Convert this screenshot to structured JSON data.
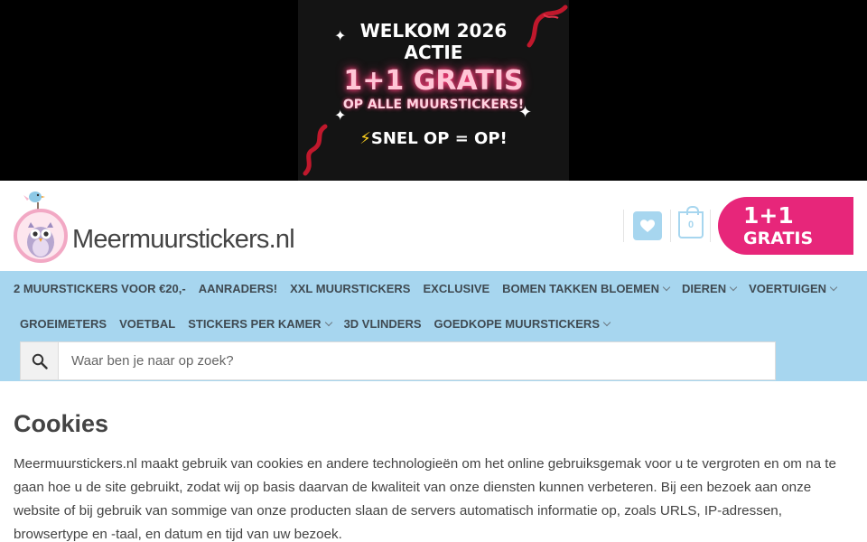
{
  "promo_banner": {
    "line1": "WELKOM 2026",
    "line2": "ACTIE",
    "line3": "1+1 GRATIS",
    "line4": "OP ALLE MUURSTICKERS!",
    "line5_icon": "lightning-icon",
    "line5": "SNEL OP = OP!"
  },
  "header": {
    "logo_text": "Meermuurstickers.nl",
    "wishlist_icon": "heart-icon",
    "cart_count": "0",
    "promo_badge": {
      "line1": "1+1",
      "line2": "GRATIS"
    }
  },
  "nav": {
    "row1": [
      {
        "label": "2 MUURSTICKERS VOOR €20,-",
        "dropdown": false
      },
      {
        "label": "AANRADERS!",
        "dropdown": false
      },
      {
        "label": "XXL MUURSTICKERS",
        "dropdown": false
      },
      {
        "label": "EXCLUSIVE",
        "dropdown": false
      },
      {
        "label": "BOMEN TAKKEN BLOEMEN",
        "dropdown": true
      },
      {
        "label": "DIEREN",
        "dropdown": true
      },
      {
        "label": "VOERTUIGEN",
        "dropdown": true
      }
    ],
    "row2": [
      {
        "label": "GROEIMETERS",
        "dropdown": false
      },
      {
        "label": "VOETBAL",
        "dropdown": false
      },
      {
        "label": "STICKERS PER KAMER",
        "dropdown": true
      },
      {
        "label": "3D VLINDERS",
        "dropdown": false
      },
      {
        "label": "GOEDKOPE MUURSTICKERS",
        "dropdown": true
      }
    ]
  },
  "search": {
    "placeholder": "Waar ben je naar op zoek?",
    "value": ""
  },
  "content": {
    "title": "Cookies",
    "paragraph": "Meermuurstickers.nl maakt gebruik van cookies en andere technologieën om het online gebruiksgemak voor u te vergroten en om na te gaan hoe u de site gebruikt, zodat wij op basis daarvan de kwaliteit van onze diensten kunnen verbeteren. Bij een bezoek aan onze website of bij gebruik van sommige van onze producten slaan de servers automatisch informatie op, zoals URLS, IP-adressen, browsertype en -taal, en datum en tijd van uw bezoek."
  },
  "colors": {
    "nav_bg": "#a7d6ef",
    "accent_pink": "#e7267a",
    "banner_bg": "#000000"
  }
}
